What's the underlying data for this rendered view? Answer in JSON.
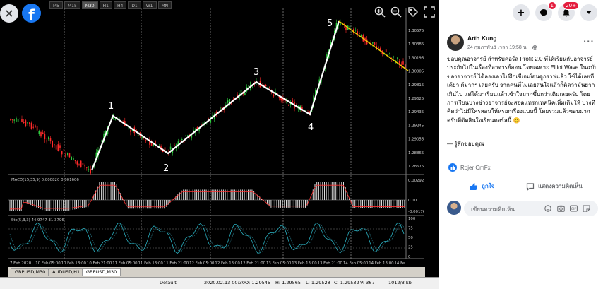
{
  "viewer": {
    "close_icon": "close-icon",
    "facebook_logo": "facebook-logo",
    "tools": [
      "zoom-in-icon",
      "zoom-out-icon",
      "tag-icon",
      "fullscreen-icon"
    ]
  },
  "chart": {
    "timeframes": [
      "M5",
      "M15",
      "M30",
      "H1",
      "H4",
      "D1",
      "W1",
      "MN"
    ],
    "active_timeframe": "M30",
    "price_ticks": [
      "1.30575",
      "1.30385",
      "1.30195",
      "1.30005",
      "1.29815",
      "1.29625",
      "1.29435",
      "1.29245",
      "1.29055",
      "1.28865",
      "1.28675"
    ],
    "macd_label": "MACD(15,35,9) 0.000820 0.001606",
    "macd_ticks": [
      "0.00292",
      "0.00",
      "-0.00176"
    ],
    "stoch_label": "Sto(5,3,3) 44.9747 31.3796",
    "stoch_ticks": [
      "100",
      "75",
      "50",
      "25",
      "0"
    ],
    "date_ticks": [
      "7 Feb 2020",
      "10 Feb 05:00",
      "10 Feb 13:00",
      "10 Feb 21:00",
      "11 Feb 05:00",
      "11 Feb 13:00",
      "11 Feb 21:00",
      "12 Feb 05:00",
      "12 Feb 13:00",
      "12 Feb 21:00",
      "13 Feb 05:00",
      "13 Feb 13:00",
      "13 Feb 21:00",
      "14 Feb 05:00",
      "14 Feb 13:00",
      "14 Fe"
    ],
    "wave_labels": [
      "1",
      "2",
      "3",
      "4",
      "5"
    ],
    "colors": {
      "bull": "#2ecc40",
      "bear": "#ff2a2a",
      "wave": "#ffffff",
      "trend": "#f0d000",
      "macd_line": "#ff3030"
    }
  },
  "tabs": [
    "GBPUSD,M30",
    "AUDUSD,H1",
    "GBPUSD,M30"
  ],
  "active_tab": 2,
  "status_bar": {
    "profile": "Default",
    "datetime": "2020.02.13 00:30",
    "open": "O: 1.29545",
    "high": "H: 1.29565",
    "low": "L: 1.29528",
    "close": "C: 1.29532",
    "volume": "V: 367",
    "traffic": "1012/3 kb"
  },
  "facebook": {
    "header_badges": {
      "messenger": "1",
      "notifications": "20+"
    },
    "author": "Arth Kung",
    "timestamp": "24 กุมภาพันธ์ เวลา 19:58 น. · ",
    "post_text": "ขอบคุณอาจารย์ สำหรับคอร์ส Profit 2.0 ที่ได้เรียนกับอาจารย์ ประกับไปในเรื่องที่อาจารย์สอน โดยเฉพาะ Elliot Wave ในฉบับของอาจารย์ ได้ลองเอาไปฝึกเขียนย้อนดูกราฟแล้ว ใช้ได้เลยทีเดียว ดีมากๆ เลยครับ จากคนที่ไม่เลยสนใจแล้วก็คิดว่ามันยากเกินไป แต่ได้มาเรียนแล้วเข้าใจมากขึ้นกว่าเดิมเลยครับ โดยการเรียนบางช่วงอาจารย์จะสอดแทรกเทคนิคเพิ่มเติมให้ บางทีคิดว่าไม่มีใครสอนให้หรอกเรื่องแบบนี้ โดยรวมแล้วชอบมากครับที่ตัดสินใจเรียนคอร์สนี้ 😊",
    "post_text_2": "— รู้สึกขอบคุณ",
    "reactor": "Rojer CmFx",
    "like_label": "ถูกใจ",
    "comment_label": "แสดงความคิดเห็น",
    "comment_placeholder": "เขียนความคิดเห็น..."
  }
}
